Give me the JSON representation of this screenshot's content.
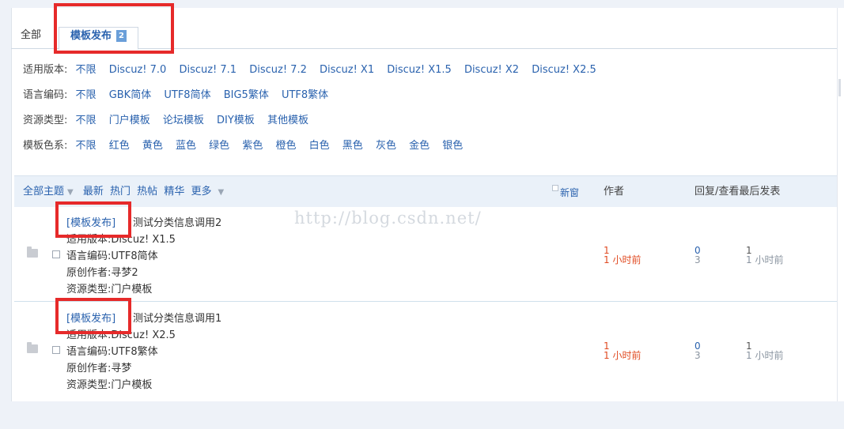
{
  "tabs": {
    "all": "全部",
    "active": "模板发布",
    "badge": "2"
  },
  "filters": [
    {
      "label": "适用版本:",
      "options": [
        "不限",
        "Discuz! 7.0",
        "Discuz! 7.1",
        "Discuz! 7.2",
        "Discuz! X1",
        "Discuz! X1.5",
        "Discuz! X2",
        "Discuz! X2.5"
      ]
    },
    {
      "label": "语言编码:",
      "options": [
        "不限",
        "GBK简体",
        "UTF8简体",
        "BIG5繁体",
        "UTF8繁体"
      ]
    },
    {
      "label": "资源类型:",
      "options": [
        "不限",
        "门户模板",
        "论坛模板",
        "DIY模板",
        "其他模板"
      ]
    },
    {
      "label": "模板色系:",
      "options": [
        "不限",
        "红色",
        "黄色",
        "蓝色",
        "绿色",
        "紫色",
        "橙色",
        "白色",
        "黑色",
        "灰色",
        "金色",
        "银色"
      ]
    }
  ],
  "list_header": {
    "all_subjects": "全部主题",
    "sorts": [
      "最新",
      "热门",
      "热帖",
      "精华",
      "更多"
    ],
    "new_window": "新窗",
    "author": "作者",
    "reply_view_last": "回复/查看最后发表"
  },
  "watermark": "http://blog.csdn.net/",
  "threads": [
    {
      "type": "[模板发布]",
      "title": "测试分类信息调用2",
      "info": [
        "适用版本:Discuz! X1.5",
        "语言编码:UTF8简体",
        "原创作者:寻梦2",
        "资源类型:门户模板"
      ],
      "author": "1",
      "author_time": "1 小时前",
      "replies": "0",
      "views": "3",
      "last_author": "1",
      "last_time": "1 小时前"
    },
    {
      "type": "[模板发布]",
      "title": "测试分类信息调用1",
      "info": [
        "适用版本:Discuz! X2.5",
        "语言编码:UTF8繁体",
        "原创作者:寻梦",
        "资源类型:门户模板"
      ],
      "author": "1",
      "author_time": "1 小时前",
      "replies": "0",
      "views": "3",
      "last_author": "1",
      "last_time": "1 小时前"
    }
  ],
  "colors": {
    "link": "#2a62ae",
    "highlight": "#e62a2a",
    "time_accent": "#e04a21"
  }
}
